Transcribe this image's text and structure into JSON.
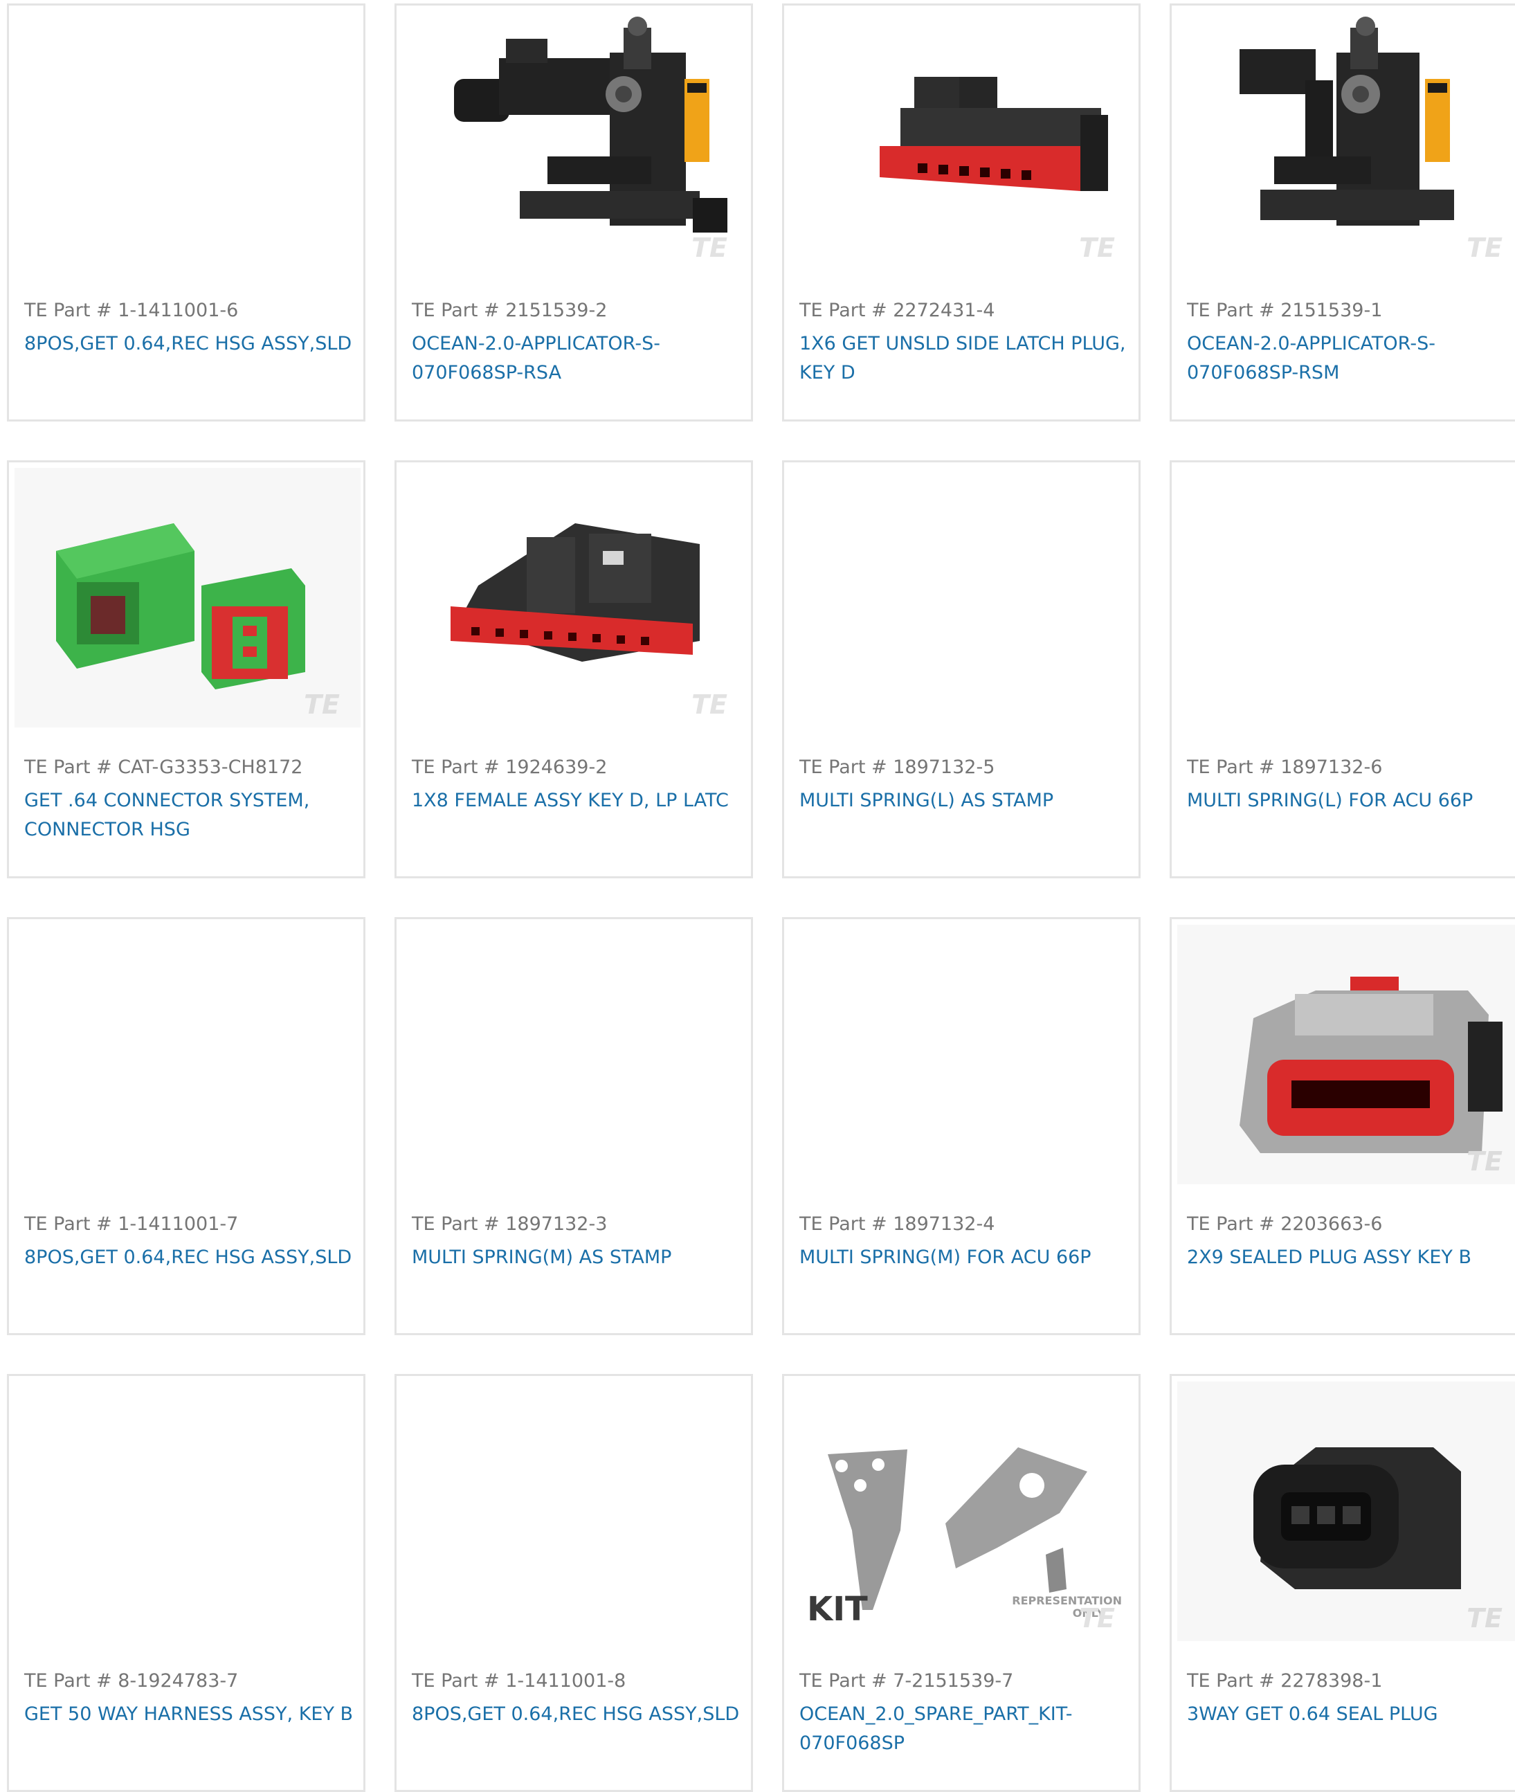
{
  "cards": [
    {
      "part_label": "TE Part # 1-1411001-6",
      "title": "8POS,GET 0.64,REC HSG ASSY,SLD",
      "image": "none"
    },
    {
      "part_label": "TE Part # 2151539-2",
      "title": "OCEAN-2.0-APPLICATOR-S-070F068SP-RSA",
      "image": "applicator",
      "watermark": "TE"
    },
    {
      "part_label": "TE Part # 2272431-4",
      "title": "1X6 GET UNSLD SIDE LATCH PLUG, KEY D",
      "image": "red-black-plug",
      "watermark": "TE"
    },
    {
      "part_label": "TE Part # 2151539-1",
      "title": "OCEAN-2.0-APPLICATOR-S-070F068SP-RSM",
      "image": "applicator",
      "watermark": "TE"
    },
    {
      "part_label": "TE Part # CAT-G3353-CH8172",
      "title": "GET .64 CONNECTOR SYSTEM, CONNECTOR HSG",
      "image": "green-connectors",
      "watermark": "TE"
    },
    {
      "part_label": "TE Part # 1924639-2",
      "title": "1X8 FEMALE ASSY KEY D, LP LATC",
      "image": "red-black-housing",
      "watermark": "TE"
    },
    {
      "part_label": "TE Part # 1897132-5",
      "title": "MULTI SPRING(L) AS STAMP",
      "image": "none"
    },
    {
      "part_label": "TE Part # 1897132-6",
      "title": "MULTI SPRING(L) FOR ACU 66P",
      "image": "none"
    },
    {
      "part_label": "TE Part # 1-1411001-7",
      "title": "8POS,GET 0.64,REC HSG ASSY,SLD",
      "image": "none"
    },
    {
      "part_label": "TE Part # 1897132-3",
      "title": "MULTI SPRING(M) AS STAMP",
      "image": "none"
    },
    {
      "part_label": "TE Part # 1897132-4",
      "title": "MULTI SPRING(M) FOR ACU 66P",
      "image": "none"
    },
    {
      "part_label": "TE Part # 2203663-6",
      "title": "2X9 SEALED PLUG ASSY KEY B",
      "image": "gray-sealed-plug",
      "watermark": "TE"
    },
    {
      "part_label": "TE Part # 8-1924783-7",
      "title": "GET 50 WAY HARNESS ASSY, KEY B",
      "image": "none"
    },
    {
      "part_label": "TE Part # 1-1411001-8",
      "title": "8POS,GET 0.64,REC HSG ASSY,SLD",
      "image": "none"
    },
    {
      "part_label": "TE Part # 7-2151539-7",
      "title": "OCEAN_2.0_SPARE_PART_KIT-070F068SP",
      "image": "spare-kit",
      "watermark": "TE",
      "kit_label": "KIT",
      "representation_note_1": "REPRESENTATION",
      "representation_note_2": "ONLY"
    },
    {
      "part_label": "TE Part # 2278398-1",
      "title": "3WAY GET 0.64 SEAL PLUG",
      "image": "black-seal-plug",
      "watermark": "TE"
    }
  ],
  "colors": {
    "link": "#1a6fa8",
    "muted": "#757575",
    "border": "#e4e4e4"
  }
}
